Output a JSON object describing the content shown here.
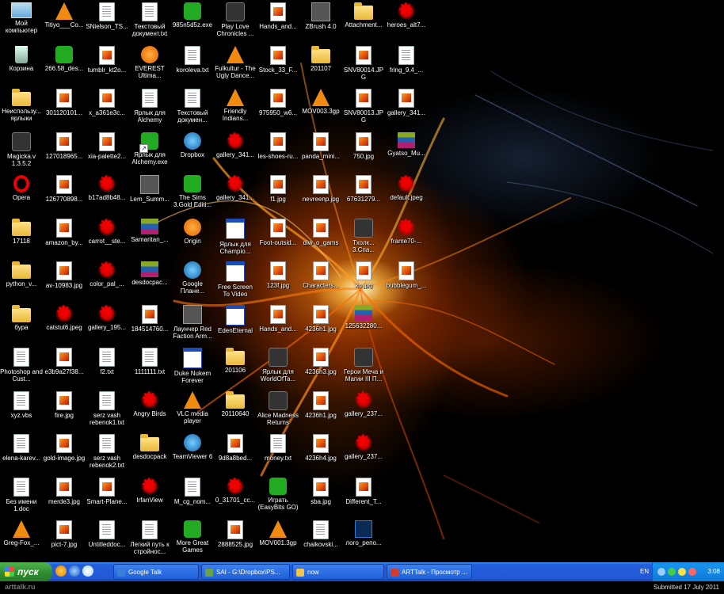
{
  "desktop": {
    "columns": [
      [
        {
          "label": "Мой компьютер",
          "icon": "my-computer-icon"
        },
        {
          "label": "Корзина",
          "icon": "recycle-bin-icon"
        },
        {
          "label": "Неиспользу... ярлыки",
          "icon": "folder-icon"
        },
        {
          "label": "Magicka.v 1.3.5.2",
          "icon": "game-icon"
        },
        {
          "label": "Opera",
          "icon": "opera-icon"
        },
        {
          "label": "17118",
          "icon": "folder-icon"
        },
        {
          "label": "python_v...",
          "icon": "folder-icon"
        },
        {
          "label": "бура",
          "icon": "folder-icon"
        },
        {
          "label": "Photoshop and Cust...",
          "icon": "document-icon"
        },
        {
          "label": "xyz.vbs",
          "icon": "script-icon"
        },
        {
          "label": "elena-karev...",
          "icon": "document-icon"
        },
        {
          "label": "Без имени 1.doc",
          "icon": "document-icon"
        },
        {
          "label": "Greg-Fox_...",
          "icon": "vlc-icon"
        }
      ],
      [
        {
          "label": "Titiyo___Co...",
          "icon": "vlc-icon"
        },
        {
          "label": "266.58_des...",
          "icon": "nvidia-icon"
        },
        {
          "label": "301120101...",
          "icon": "image-icon"
        },
        {
          "label": "127018965...",
          "icon": "image-icon"
        },
        {
          "label": "126770898...",
          "icon": "image-icon"
        },
        {
          "label": "amazon_by...",
          "icon": "image-icon"
        },
        {
          "label": "av-10983.jpg",
          "icon": "image-icon"
        },
        {
          "label": "catstut6.jpeg",
          "icon": "splat-icon"
        },
        {
          "label": "e3b9a27f38...",
          "icon": "image-icon"
        },
        {
          "label": "fire.jpg",
          "icon": "image-icon"
        },
        {
          "label": "gold-image.jpg",
          "icon": "image-icon"
        },
        {
          "label": "merde3.jpg",
          "icon": "image-icon"
        },
        {
          "label": "pict-7.jpg",
          "icon": "image-icon"
        }
      ],
      [
        {
          "label": "SNielson_TS...",
          "icon": "document-icon"
        },
        {
          "label": "tumblr_kt2o...",
          "icon": "image-icon"
        },
        {
          "label": "x_a361e3c...",
          "icon": "image-icon"
        },
        {
          "label": "xia-palette2...",
          "icon": "image-icon"
        },
        {
          "label": "b17ad8b48...",
          "icon": "splat-icon"
        },
        {
          "label": "carrot__ste...",
          "icon": "splat-icon"
        },
        {
          "label": "color_pal_...",
          "icon": "splat-icon"
        },
        {
          "label": "gallery_195...",
          "icon": "splat-icon"
        },
        {
          "label": "f2.txt",
          "icon": "document-icon"
        },
        {
          "label": "serz vash rebenok1.txt",
          "icon": "document-icon"
        },
        {
          "label": "serz vash rebenok2.txt",
          "icon": "document-icon"
        },
        {
          "label": "Smart-Plane...",
          "icon": "image-icon"
        },
        {
          "label": "Untitleddoc...",
          "icon": "document-icon"
        }
      ],
      [
        {
          "label": "Текстовый документ.txt",
          "icon": "document-icon"
        },
        {
          "label": "EVEREST Ultima...",
          "icon": "everest-icon"
        },
        {
          "label": "Ярлык для Alchemy",
          "icon": "document-icon"
        },
        {
          "label": "Ярлык для Alchemy.exe",
          "icon": "shortcut-icon"
        },
        {
          "label": "Lem_Summ...",
          "icon": "app-icon"
        },
        {
          "label": "Samaritan_...",
          "icon": "archive-icon"
        },
        {
          "label": "desdocpac...",
          "icon": "archive-icon"
        },
        {
          "label": "184514760...",
          "icon": "image-icon"
        },
        {
          "label": "1111111.txt",
          "icon": "document-icon"
        },
        {
          "label": "Angry Birds",
          "icon": "angry-birds-icon"
        },
        {
          "label": "desdocpack",
          "icon": "folder-icon"
        },
        {
          "label": "IrfanView",
          "icon": "splat-icon"
        },
        {
          "label": "Легкий путь к стройнос...",
          "icon": "document-icon"
        }
      ],
      [
        {
          "label": "985n5d5z.exe",
          "icon": "green-app-icon"
        },
        {
          "label": "koroleva.txt",
          "icon": "document-icon"
        },
        {
          "label": "Текстовый докумен...",
          "icon": "document-icon"
        },
        {
          "label": "Dropbox",
          "icon": "dropbox-icon"
        },
        {
          "label": "The Sims 3.Gold Editi...",
          "icon": "sims-icon"
        },
        {
          "label": "Origin",
          "icon": "origin-icon"
        },
        {
          "label": "Google Плане...",
          "icon": "google-earth-icon"
        },
        {
          "label": "Лаунчер Red Faction Arm...",
          "icon": "app-icon"
        },
        {
          "label": "Duke Nukem Forever",
          "icon": "window-icon"
        },
        {
          "label": "VLC media player",
          "icon": "vlc-icon"
        },
        {
          "label": "TeamViewer 6",
          "icon": "teamviewer-icon"
        },
        {
          "label": "M_cg_nom...",
          "icon": "document-icon"
        },
        {
          "label": "More Great Games",
          "icon": "green-app-icon"
        }
      ],
      [
        {
          "label": "Play Love Chronicles ...",
          "icon": "game-icon"
        },
        {
          "label": "Fulkultur - The Ugly Dance...",
          "icon": "vlc-icon"
        },
        {
          "label": "Friendly Indians...",
          "icon": "vlc-icon"
        },
        {
          "label": "gallery_341...",
          "icon": "splat-icon"
        },
        {
          "label": "gallery_341...",
          "icon": "splat-icon"
        },
        {
          "label": "Ярлык для Champio...",
          "icon": "window-icon"
        },
        {
          "label": "Free Screen To Video",
          "icon": "window-icon"
        },
        {
          "label": "EdenEternal",
          "icon": "window-icon"
        },
        {
          "label": "201106",
          "icon": "folder-icon"
        },
        {
          "label": "20110640",
          "icon": "folder-icon"
        },
        {
          "label": "9d8a8bed...",
          "icon": "image-icon"
        },
        {
          "label": "0_31701_cc...",
          "icon": "splat-icon"
        },
        {
          "label": "2888525.jpg",
          "icon": "image-icon"
        }
      ],
      [
        {
          "label": "Hands_and...",
          "icon": "image-icon"
        },
        {
          "label": "Stock_33_F...",
          "icon": "image-icon"
        },
        {
          "label": "975950_w6...",
          "icon": "image-icon"
        },
        {
          "label": "les-shoes-ru...",
          "icon": "image-icon"
        },
        {
          "label": "f1.jpg",
          "icon": "image-icon"
        },
        {
          "label": "Foot-outsid...",
          "icon": "image-icon"
        },
        {
          "label": "123f.jpg",
          "icon": "image-icon"
        },
        {
          "label": "Hands_and...",
          "icon": "image-icon"
        },
        {
          "label": "Ярлык для WorldOfTa...",
          "icon": "game-icon"
        },
        {
          "label": "Alice Madness Returns",
          "icon": "game-icon"
        },
        {
          "label": "money.txt",
          "icon": "document-icon"
        },
        {
          "label": "Играть (EasyBits GO)",
          "icon": "green-app-icon"
        },
        {
          "label": "MOV001.3gp",
          "icon": "vlc-icon"
        }
      ],
      [
        {
          "label": "ZBrush 4.0",
          "icon": "app-icon"
        },
        {
          "label": "201107",
          "icon": "folder-icon"
        },
        {
          "label": "MOV003.3gp",
          "icon": "vlc-icon"
        },
        {
          "label": "panda_mini...",
          "icon": "image-icon"
        },
        {
          "label": "nevreenp.jpg",
          "icon": "image-icon"
        },
        {
          "label": "diw_o_gams",
          "icon": "image-icon"
        },
        {
          "label": "Characters...",
          "icon": "image-icon"
        },
        {
          "label": "4236h1.jpg",
          "icon": "image-icon"
        },
        {
          "label": "4236h3.jpg",
          "icon": "image-icon"
        },
        {
          "label": "4236h1.jpg",
          "icon": "image-icon"
        },
        {
          "label": "4236h4.jpg",
          "icon": "image-icon"
        },
        {
          "label": "sba.jpg",
          "icon": "image-icon"
        },
        {
          "label": "chaikovski...",
          "icon": "document-icon"
        }
      ],
      [
        {
          "label": "Attachment...",
          "icon": "folder-icon"
        },
        {
          "label": "SNV80014.JPG",
          "icon": "image-icon"
        },
        {
          "label": "SNV80013.JPG",
          "icon": "image-icon"
        },
        {
          "label": "750.jpg",
          "icon": "image-icon"
        },
        {
          "label": "67631279...",
          "icon": "image-icon"
        },
        {
          "label": "Тхолк... 3.Спа...",
          "icon": "game-icon"
        },
        {
          "label": "ko.jpg",
          "icon": "image-icon"
        },
        {
          "label": "125632280...",
          "icon": "archive-icon"
        },
        {
          "label": "Герои Меча и Магии III П...",
          "icon": "game-icon"
        },
        {
          "label": "gallery_237...",
          "icon": "splat-icon"
        },
        {
          "label": "gallery_237...",
          "icon": "splat-icon"
        },
        {
          "label": "Different_T...",
          "icon": "image-icon"
        },
        {
          "label": "лого_репо...",
          "icon": "photoshop-icon"
        }
      ],
      [
        {
          "label": "heroes_alt7...",
          "icon": "splat-icon"
        },
        {
          "label": "fring_9.4_...",
          "icon": "document-icon"
        },
        {
          "label": "gallery_341...",
          "icon": "image-icon"
        },
        {
          "label": "Gyatso_Mu...",
          "icon": "archive-icon"
        },
        {
          "label": "default.jpeg",
          "icon": "splat-icon"
        },
        {
          "label": "frame70-...",
          "icon": "splat-icon"
        },
        {
          "label": "bubblegum_...",
          "icon": "image-icon"
        }
      ]
    ]
  },
  "taskbar": {
    "start_label": "пуск",
    "tasks": [
      {
        "label": "Google Talk",
        "color": "#3a7fd5"
      },
      {
        "label": "SAI - G:\\Dropbox\\PS...",
        "color": "#6aa34a"
      },
      {
        "label": "now",
        "color": "#f2c64a"
      },
      {
        "label": "ARTTalk - Просмотр ...",
        "color": "#d43b2a"
      }
    ],
    "language": "EN",
    "clock": "3:08"
  },
  "footer": {
    "watermark": "arttalk.ru",
    "submitted": "Submitted 17 July 2011"
  }
}
